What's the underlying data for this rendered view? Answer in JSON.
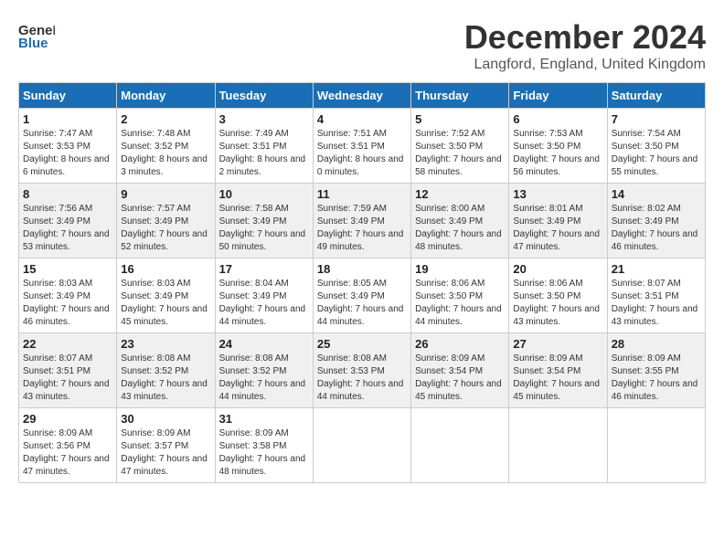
{
  "header": {
    "logo_line1": "General",
    "logo_line2": "Blue",
    "month": "December 2024",
    "location": "Langford, England, United Kingdom"
  },
  "days_of_week": [
    "Sunday",
    "Monday",
    "Tuesday",
    "Wednesday",
    "Thursday",
    "Friday",
    "Saturday"
  ],
  "weeks": [
    [
      {
        "day": "1",
        "sunrise": "Sunrise: 7:47 AM",
        "sunset": "Sunset: 3:53 PM",
        "daylight": "Daylight: 8 hours and 6 minutes."
      },
      {
        "day": "2",
        "sunrise": "Sunrise: 7:48 AM",
        "sunset": "Sunset: 3:52 PM",
        "daylight": "Daylight: 8 hours and 3 minutes."
      },
      {
        "day": "3",
        "sunrise": "Sunrise: 7:49 AM",
        "sunset": "Sunset: 3:51 PM",
        "daylight": "Daylight: 8 hours and 2 minutes."
      },
      {
        "day": "4",
        "sunrise": "Sunrise: 7:51 AM",
        "sunset": "Sunset: 3:51 PM",
        "daylight": "Daylight: 8 hours and 0 minutes."
      },
      {
        "day": "5",
        "sunrise": "Sunrise: 7:52 AM",
        "sunset": "Sunset: 3:50 PM",
        "daylight": "Daylight: 7 hours and 58 minutes."
      },
      {
        "day": "6",
        "sunrise": "Sunrise: 7:53 AM",
        "sunset": "Sunset: 3:50 PM",
        "daylight": "Daylight: 7 hours and 56 minutes."
      },
      {
        "day": "7",
        "sunrise": "Sunrise: 7:54 AM",
        "sunset": "Sunset: 3:50 PM",
        "daylight": "Daylight: 7 hours and 55 minutes."
      }
    ],
    [
      {
        "day": "8",
        "sunrise": "Sunrise: 7:56 AM",
        "sunset": "Sunset: 3:49 PM",
        "daylight": "Daylight: 7 hours and 53 minutes."
      },
      {
        "day": "9",
        "sunrise": "Sunrise: 7:57 AM",
        "sunset": "Sunset: 3:49 PM",
        "daylight": "Daylight: 7 hours and 52 minutes."
      },
      {
        "day": "10",
        "sunrise": "Sunrise: 7:58 AM",
        "sunset": "Sunset: 3:49 PM",
        "daylight": "Daylight: 7 hours and 50 minutes."
      },
      {
        "day": "11",
        "sunrise": "Sunrise: 7:59 AM",
        "sunset": "Sunset: 3:49 PM",
        "daylight": "Daylight: 7 hours and 49 minutes."
      },
      {
        "day": "12",
        "sunrise": "Sunrise: 8:00 AM",
        "sunset": "Sunset: 3:49 PM",
        "daylight": "Daylight: 7 hours and 48 minutes."
      },
      {
        "day": "13",
        "sunrise": "Sunrise: 8:01 AM",
        "sunset": "Sunset: 3:49 PM",
        "daylight": "Daylight: 7 hours and 47 minutes."
      },
      {
        "day": "14",
        "sunrise": "Sunrise: 8:02 AM",
        "sunset": "Sunset: 3:49 PM",
        "daylight": "Daylight: 7 hours and 46 minutes."
      }
    ],
    [
      {
        "day": "15",
        "sunrise": "Sunrise: 8:03 AM",
        "sunset": "Sunset: 3:49 PM",
        "daylight": "Daylight: 7 hours and 46 minutes."
      },
      {
        "day": "16",
        "sunrise": "Sunrise: 8:03 AM",
        "sunset": "Sunset: 3:49 PM",
        "daylight": "Daylight: 7 hours and 45 minutes."
      },
      {
        "day": "17",
        "sunrise": "Sunrise: 8:04 AM",
        "sunset": "Sunset: 3:49 PM",
        "daylight": "Daylight: 7 hours and 44 minutes."
      },
      {
        "day": "18",
        "sunrise": "Sunrise: 8:05 AM",
        "sunset": "Sunset: 3:49 PM",
        "daylight": "Daylight: 7 hours and 44 minutes."
      },
      {
        "day": "19",
        "sunrise": "Sunrise: 8:06 AM",
        "sunset": "Sunset: 3:50 PM",
        "daylight": "Daylight: 7 hours and 44 minutes."
      },
      {
        "day": "20",
        "sunrise": "Sunrise: 8:06 AM",
        "sunset": "Sunset: 3:50 PM",
        "daylight": "Daylight: 7 hours and 43 minutes."
      },
      {
        "day": "21",
        "sunrise": "Sunrise: 8:07 AM",
        "sunset": "Sunset: 3:51 PM",
        "daylight": "Daylight: 7 hours and 43 minutes."
      }
    ],
    [
      {
        "day": "22",
        "sunrise": "Sunrise: 8:07 AM",
        "sunset": "Sunset: 3:51 PM",
        "daylight": "Daylight: 7 hours and 43 minutes."
      },
      {
        "day": "23",
        "sunrise": "Sunrise: 8:08 AM",
        "sunset": "Sunset: 3:52 PM",
        "daylight": "Daylight: 7 hours and 43 minutes."
      },
      {
        "day": "24",
        "sunrise": "Sunrise: 8:08 AM",
        "sunset": "Sunset: 3:52 PM",
        "daylight": "Daylight: 7 hours and 44 minutes."
      },
      {
        "day": "25",
        "sunrise": "Sunrise: 8:08 AM",
        "sunset": "Sunset: 3:53 PM",
        "daylight": "Daylight: 7 hours and 44 minutes."
      },
      {
        "day": "26",
        "sunrise": "Sunrise: 8:09 AM",
        "sunset": "Sunset: 3:54 PM",
        "daylight": "Daylight: 7 hours and 45 minutes."
      },
      {
        "day": "27",
        "sunrise": "Sunrise: 8:09 AM",
        "sunset": "Sunset: 3:54 PM",
        "daylight": "Daylight: 7 hours and 45 minutes."
      },
      {
        "day": "28",
        "sunrise": "Sunrise: 8:09 AM",
        "sunset": "Sunset: 3:55 PM",
        "daylight": "Daylight: 7 hours and 46 minutes."
      }
    ],
    [
      {
        "day": "29",
        "sunrise": "Sunrise: 8:09 AM",
        "sunset": "Sunset: 3:56 PM",
        "daylight": "Daylight: 7 hours and 47 minutes."
      },
      {
        "day": "30",
        "sunrise": "Sunrise: 8:09 AM",
        "sunset": "Sunset: 3:57 PM",
        "daylight": "Daylight: 7 hours and 47 minutes."
      },
      {
        "day": "31",
        "sunrise": "Sunrise: 8:09 AM",
        "sunset": "Sunset: 3:58 PM",
        "daylight": "Daylight: 7 hours and 48 minutes."
      },
      null,
      null,
      null,
      null
    ]
  ]
}
